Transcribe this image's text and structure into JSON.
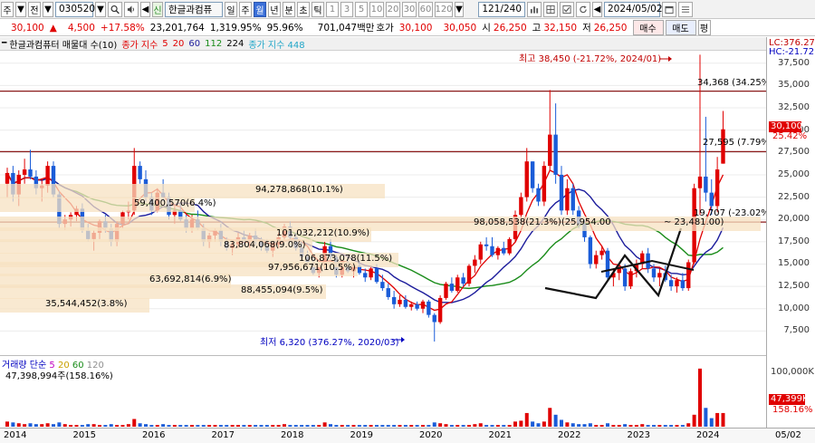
{
  "toolbar": {
    "menu_label": "주",
    "type_label": "전",
    "code": "030520",
    "stock_name": "한글과컴퓨",
    "stock_tag": "신",
    "periods": [
      "일",
      "주",
      "월",
      "년",
      "분",
      "초",
      "틱"
    ],
    "active_period": "월",
    "intervals": [
      "1",
      "3",
      "5",
      "10",
      "20",
      "30",
      "60",
      "120"
    ],
    "count": "121/240",
    "date": "2024/05/02"
  },
  "quote": {
    "price": "30,100",
    "change_arrow": "▲",
    "change": "4,500",
    "change_pct": "+17.58%",
    "volume": "23,201,764",
    "vol_ratio": "1,319.95%",
    "turnover_pct": "95.96%",
    "amount": "701,047백만",
    "bid_label": "호가",
    "bid1": "30,100",
    "bid2": "30,050",
    "open_label": "시",
    "open": "26,250",
    "high_label": "고",
    "high": "32,150",
    "low_label": "저",
    "low": "26,250",
    "buy_label": "매수",
    "sell_label": "매도",
    "eval_label": "평"
  },
  "legend": {
    "title": "한글과컴퓨터 매물대 수(10)",
    "ma_label": "종가 지수",
    "ma": [
      "5",
      "20",
      "60",
      "112",
      "224"
    ],
    "ma_colors": [
      "#b4b4b4",
      "#e00000",
      "#1c1c9c",
      "#1a8c1a",
      "#000000"
    ],
    "ma2": "종가 지수 448",
    "ma2_color": "#22a6c8"
  },
  "right_axis": {
    "lc": "LC:376.27",
    "hc": "HC:-21.72",
    "ticks": [
      "37,500",
      "35,000",
      "32,500",
      "30,000",
      "27,500",
      "25,000",
      "22,500",
      "20,000",
      "17,500",
      "15,000",
      "12,500",
      "10,000",
      "7,500"
    ],
    "price_tag": "30,100",
    "price_pct": "25.42%",
    "vol_ticks": [
      "100,000K"
    ],
    "vol_tag": "47,399K",
    "vol_pct": "158.16%"
  },
  "annotations": {
    "high": "최고 38,450 (-21.72%, 2024/01)",
    "low": "최저 6,320 (376.27%, 2020/03)",
    "level1": "34,368 (34.25%)",
    "level2": "27,595 (7.79%)",
    "level3": "19,707 (-23.02%)",
    "range_label": "~ 23,481.00)"
  },
  "volume_profile": [
    "94,278,868(10.1%)",
    "59,400,570(6.4%)",
    "98,058,538(21.3%)(25,954.00",
    "101,032,212(10.9%)",
    "83,804,068(9.0%)",
    "106,873,078(11.5%)",
    "97,956,671(10.5%)",
    "63,692,814(6.9%)",
    "88,455,094(9.5%)",
    "35,544,452(3.8%)"
  ],
  "volume_panel": {
    "title": "거래량",
    "ma_label": "단순",
    "ma": [
      "5",
      "20",
      "60",
      "120"
    ],
    "ma_colors": [
      "#c000c0",
      "#c8a000",
      "#1a8c1a",
      "#909090"
    ],
    "value": "47,398,994주(158.16%)"
  },
  "x_axis": {
    "years": [
      "2014",
      "2015",
      "2016",
      "2017",
      "2018",
      "2019",
      "2020",
      "2021",
      "2022",
      "2023",
      "2024"
    ],
    "end_date": "05/02"
  },
  "chart_data": {
    "type": "candlestick",
    "period": "monthly",
    "y_range": [
      6000,
      38500
    ],
    "candles": [
      [
        2014,
        1,
        24000,
        25800,
        22500,
        25200
      ],
      [
        2014,
        2,
        25200,
        26000,
        22000,
        22800
      ],
      [
        2014,
        3,
        22800,
        25500,
        21500,
        25000
      ],
      [
        2014,
        4,
        25000,
        26800,
        24000,
        25600
      ],
      [
        2014,
        5,
        25600,
        27800,
        24500,
        24800
      ],
      [
        2014,
        6,
        24800,
        25500,
        22800,
        23500
      ],
      [
        2014,
        7,
        23500,
        24500,
        22000,
        23800
      ],
      [
        2014,
        8,
        23800,
        26500,
        23000,
        26000
      ],
      [
        2014,
        9,
        26000,
        26500,
        22500,
        22800
      ],
      [
        2014,
        10,
        22800,
        23200,
        19000,
        19500
      ],
      [
        2014,
        11,
        19500,
        20500,
        18800,
        20000
      ],
      [
        2014,
        12,
        20000,
        20800,
        19200,
        20500
      ],
      [
        2015,
        1,
        20500,
        21500,
        19800,
        21200
      ],
      [
        2015,
        2,
        21200,
        21800,
        18500,
        18800
      ],
      [
        2015,
        3,
        18800,
        19500,
        17500,
        17800
      ],
      [
        2015,
        4,
        17800,
        18800,
        16500,
        18500
      ],
      [
        2015,
        5,
        18500,
        20000,
        17800,
        19800
      ],
      [
        2015,
        6,
        19800,
        20500,
        18500,
        19000
      ],
      [
        2015,
        7,
        19000,
        19500,
        17000,
        17500
      ],
      [
        2015,
        8,
        17500,
        19800,
        17000,
        19500
      ],
      [
        2015,
        9,
        19500,
        21000,
        19000,
        20800
      ],
      [
        2015,
        10,
        20800,
        22000,
        20000,
        21000
      ],
      [
        2015,
        11,
        21000,
        28000,
        20500,
        26000
      ],
      [
        2015,
        12,
        26000,
        26500,
        24000,
        24500
      ],
      [
        2016,
        1,
        24500,
        25500,
        22000,
        22500
      ],
      [
        2016,
        2,
        22500,
        23000,
        20500,
        21000
      ],
      [
        2016,
        3,
        21000,
        23500,
        20800,
        23000
      ],
      [
        2016,
        4,
        23000,
        24500,
        22000,
        22500
      ],
      [
        2016,
        5,
        22500,
        23000,
        20000,
        20500
      ],
      [
        2016,
        6,
        20500,
        21500,
        19500,
        21000
      ],
      [
        2016,
        7,
        21000,
        21800,
        19800,
        20000
      ],
      [
        2016,
        8,
        20000,
        20500,
        18500,
        19000
      ],
      [
        2016,
        9,
        19000,
        20500,
        18500,
        20000
      ],
      [
        2016,
        10,
        20000,
        21000,
        18800,
        19000
      ],
      [
        2016,
        11,
        19000,
        19500,
        17000,
        17500
      ],
      [
        2016,
        12,
        17500,
        18500,
        16800,
        18200
      ],
      [
        2017,
        1,
        18200,
        19000,
        17500,
        18800
      ],
      [
        2017,
        2,
        18800,
        19500,
        17000,
        17500
      ],
      [
        2017,
        3,
        17500,
        18000,
        16500,
        16800
      ],
      [
        2017,
        4,
        16800,
        17500,
        16000,
        17200
      ],
      [
        2017,
        5,
        17200,
        18500,
        16800,
        18000
      ],
      [
        2017,
        6,
        18000,
        18800,
        17200,
        17500
      ],
      [
        2017,
        7,
        17500,
        18500,
        16800,
        18200
      ],
      [
        2017,
        8,
        18200,
        19000,
        17200,
        17500
      ],
      [
        2017,
        9,
        17500,
        18000,
        16500,
        17000
      ],
      [
        2017,
        10,
        17000,
        17800,
        16200,
        16500
      ],
      [
        2017,
        11,
        16500,
        17500,
        15800,
        17200
      ],
      [
        2017,
        12,
        17200,
        18500,
        16800,
        18000
      ],
      [
        2018,
        1,
        18000,
        19500,
        17500,
        19200
      ],
      [
        2018,
        2,
        19200,
        19800,
        17800,
        18000
      ],
      [
        2018,
        3,
        18000,
        18500,
        16500,
        16800
      ],
      [
        2018,
        4,
        16800,
        17500,
        15500,
        15800
      ],
      [
        2018,
        5,
        15800,
        16500,
        14800,
        15200
      ],
      [
        2018,
        6,
        15200,
        15800,
        13800,
        14000
      ],
      [
        2018,
        7,
        14000,
        15000,
        13500,
        14800
      ],
      [
        2018,
        8,
        14800,
        17500,
        14500,
        17000
      ],
      [
        2018,
        9,
        17000,
        17800,
        15500,
        15800
      ],
      [
        2018,
        10,
        15800,
        16000,
        13500,
        13800
      ],
      [
        2018,
        11,
        13800,
        15500,
        13500,
        15200
      ],
      [
        2018,
        12,
        15200,
        15800,
        14000,
        14200
      ],
      [
        2019,
        1,
        14200,
        15000,
        13500,
        14800
      ],
      [
        2019,
        2,
        14800,
        15500,
        13800,
        14000
      ],
      [
        2019,
        3,
        14000,
        14500,
        13000,
        13500
      ],
      [
        2019,
        4,
        13500,
        14800,
        13200,
        14500
      ],
      [
        2019,
        5,
        14500,
        15000,
        12800,
        13000
      ],
      [
        2019,
        6,
        13000,
        13800,
        12000,
        12300
      ],
      [
        2019,
        7,
        12300,
        12800,
        11000,
        11300
      ],
      [
        2019,
        8,
        11300,
        12000,
        10000,
        10500
      ],
      [
        2019,
        9,
        10500,
        11500,
        10200,
        11000
      ],
      [
        2019,
        10,
        11000,
        11500,
        10000,
        10200
      ],
      [
        2019,
        11,
        10200,
        10800,
        9800,
        10500
      ],
      [
        2019,
        12,
        10500,
        10800,
        9800,
        10000
      ],
      [
        2020,
        1,
        10000,
        11000,
        9500,
        10800
      ],
      [
        2020,
        2,
        10800,
        11000,
        9000,
        9300
      ],
      [
        2020,
        3,
        9300,
        9500,
        6320,
        8500
      ],
      [
        2020,
        4,
        8500,
        11500,
        8300,
        11200
      ],
      [
        2020,
        5,
        11200,
        13000,
        11000,
        12800
      ],
      [
        2020,
        6,
        12800,
        13500,
        11800,
        12000
      ],
      [
        2020,
        7,
        12000,
        13800,
        11800,
        13500
      ],
      [
        2020,
        8,
        13500,
        14000,
        12500,
        12800
      ],
      [
        2020,
        9,
        12800,
        15000,
        12500,
        14800
      ],
      [
        2020,
        10,
        14800,
        16000,
        14000,
        15500
      ],
      [
        2020,
        11,
        15500,
        17500,
        15000,
        17200
      ],
      [
        2020,
        12,
        17200,
        18000,
        16500,
        17000
      ],
      [
        2021,
        1,
        17000,
        18000,
        15800,
        16000
      ],
      [
        2021,
        2,
        16000,
        17000,
        15500,
        16800
      ],
      [
        2021,
        3,
        16800,
        17500,
        16000,
        16200
      ],
      [
        2021,
        4,
        16200,
        18000,
        16000,
        17800
      ],
      [
        2021,
        5,
        17800,
        21000,
        17500,
        20500
      ],
      [
        2021,
        6,
        20500,
        23000,
        20000,
        22500
      ],
      [
        2021,
        7,
        22500,
        28000,
        22000,
        26500
      ],
      [
        2021,
        8,
        26500,
        26500,
        23000,
        23500
      ],
      [
        2021,
        9,
        23500,
        24000,
        21500,
        22000
      ],
      [
        2021,
        10,
        22000,
        26500,
        21500,
        26000
      ],
      [
        2021,
        11,
        26000,
        34500,
        25500,
        29500
      ],
      [
        2021,
        12,
        29500,
        33000,
        24000,
        25000
      ],
      [
        2022,
        1,
        25000,
        26000,
        20500,
        21000
      ],
      [
        2022,
        2,
        21000,
        24500,
        20500,
        23500
      ],
      [
        2022,
        3,
        23500,
        24000,
        20500,
        21000
      ],
      [
        2022,
        4,
        21000,
        21500,
        19000,
        19500
      ],
      [
        2022,
        5,
        19500,
        20000,
        17500,
        18000
      ],
      [
        2022,
        6,
        18000,
        18200,
        14500,
        15000
      ],
      [
        2022,
        7,
        15000,
        16500,
        14500,
        16000
      ],
      [
        2022,
        8,
        16000,
        17000,
        15500,
        16500
      ],
      [
        2022,
        9,
        16500,
        16800,
        13000,
        13500
      ],
      [
        2022,
        10,
        13500,
        14500,
        12500,
        14000
      ],
      [
        2022,
        11,
        14000,
        15000,
        13200,
        14500
      ],
      [
        2022,
        12,
        14500,
        15000,
        12000,
        12500
      ],
      [
        2023,
        1,
        12500,
        14500,
        12200,
        14200
      ],
      [
        2023,
        2,
        14200,
        15500,
        13500,
        15000
      ],
      [
        2023,
        3,
        15000,
        16500,
        14500,
        16200
      ],
      [
        2023,
        4,
        16200,
        16800,
        14000,
        14500
      ],
      [
        2023,
        5,
        14500,
        15000,
        13000,
        13500
      ],
      [
        2023,
        6,
        13500,
        14500,
        12500,
        14000
      ],
      [
        2023,
        7,
        14000,
        14800,
        13000,
        13200
      ],
      [
        2023,
        8,
        13200,
        13800,
        12000,
        12500
      ],
      [
        2023,
        9,
        12500,
        13500,
        11800,
        13200
      ],
      [
        2023,
        10,
        13200,
        14000,
        12000,
        12300
      ],
      [
        2023,
        11,
        12300,
        15500,
        12000,
        15200
      ],
      [
        2023,
        12,
        15200,
        24000,
        15000,
        23500
      ],
      [
        2024,
        1,
        23500,
        38450,
        20500,
        24800
      ],
      [
        2024,
        2,
        24800,
        31500,
        22000,
        23000
      ],
      [
        2024,
        3,
        23000,
        24500,
        20500,
        21500
      ],
      [
        2024,
        4,
        21500,
        27000,
        20800,
        25600
      ],
      [
        2024,
        5,
        26250,
        32150,
        26250,
        30100
      ]
    ]
  }
}
